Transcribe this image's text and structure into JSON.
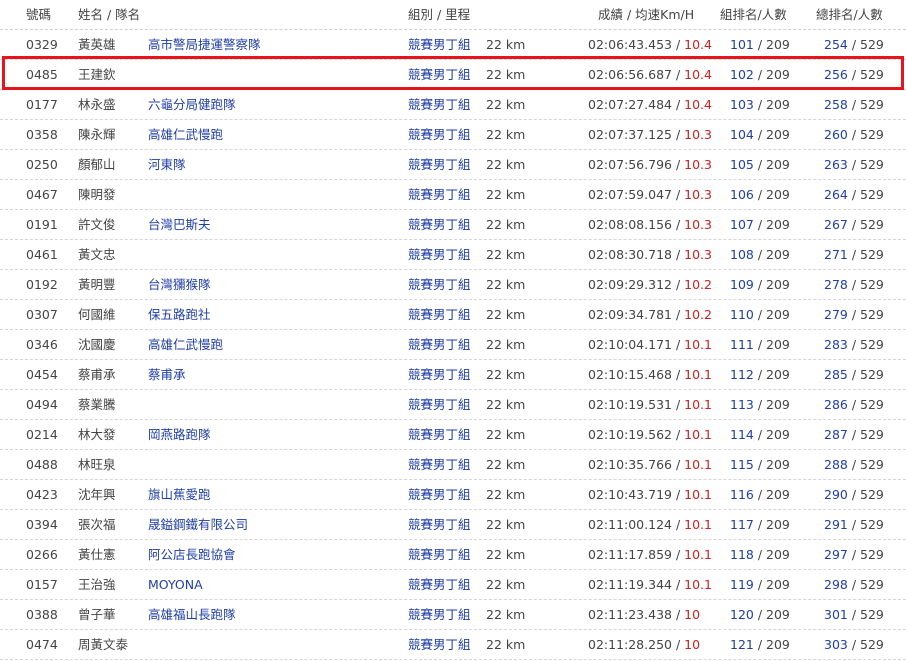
{
  "header": {
    "num": "號碼",
    "name_team": "姓名 / 隊名",
    "group_dist": "組別 / 里程",
    "time_speed": "成績 / 均速Km/H",
    "group_rank": "組排名/人數",
    "overall_rank": "總排名/人數"
  },
  "colors": {
    "link_blue": "#1f3ea8",
    "speed_red": "#cc1f1f",
    "highlight_red": "#e8141b"
  },
  "rows": [
    {
      "num": "0329",
      "name": "黃英雄",
      "team": "高市警局捷運警察隊",
      "group": "競賽男丁組",
      "dist": "22 km",
      "time": "02:06:43.453",
      "speed": "10.4",
      "grank": "101",
      "gtotal": "209",
      "orank": "254",
      "ototal": "529"
    },
    {
      "num": "0485",
      "name": "王建欽",
      "team": "",
      "group": "競賽男丁組",
      "dist": "22 km",
      "time": "02:06:56.687",
      "speed": "10.4",
      "grank": "102",
      "gtotal": "209",
      "orank": "256",
      "ototal": "529"
    },
    {
      "num": "0177",
      "name": "林永盛",
      "team": "六龜分局健跑隊",
      "group": "競賽男丁組",
      "dist": "22 km",
      "time": "02:07:27.484",
      "speed": "10.4",
      "grank": "103",
      "gtotal": "209",
      "orank": "258",
      "ototal": "529"
    },
    {
      "num": "0358",
      "name": "陳永輝",
      "team": "高雄仁武慢跑",
      "group": "競賽男丁組",
      "dist": "22 km",
      "time": "02:07:37.125",
      "speed": "10.3",
      "grank": "104",
      "gtotal": "209",
      "orank": "260",
      "ototal": "529"
    },
    {
      "num": "0250",
      "name": "顏郁山",
      "team": "河東隊",
      "group": "競賽男丁組",
      "dist": "22 km",
      "time": "02:07:56.796",
      "speed": "10.3",
      "grank": "105",
      "gtotal": "209",
      "orank": "263",
      "ototal": "529"
    },
    {
      "num": "0467",
      "name": "陳明發",
      "team": "",
      "group": "競賽男丁組",
      "dist": "22 km",
      "time": "02:07:59.047",
      "speed": "10.3",
      "grank": "106",
      "gtotal": "209",
      "orank": "264",
      "ototal": "529"
    },
    {
      "num": "0191",
      "name": "許文俊",
      "team": "台灣巴斯夫",
      "group": "競賽男丁組",
      "dist": "22 km",
      "time": "02:08:08.156",
      "speed": "10.3",
      "grank": "107",
      "gtotal": "209",
      "orank": "267",
      "ototal": "529"
    },
    {
      "num": "0461",
      "name": "黃文忠",
      "team": "",
      "group": "競賽男丁組",
      "dist": "22 km",
      "time": "02:08:30.718",
      "speed": "10.3",
      "grank": "108",
      "gtotal": "209",
      "orank": "271",
      "ototal": "529"
    },
    {
      "num": "0192",
      "name": "黃明豐",
      "team": "台灣獼猴隊",
      "group": "競賽男丁組",
      "dist": "22 km",
      "time": "02:09:29.312",
      "speed": "10.2",
      "grank": "109",
      "gtotal": "209",
      "orank": "278",
      "ototal": "529"
    },
    {
      "num": "0307",
      "name": "何國維",
      "team": "保五路跑社",
      "group": "競賽男丁組",
      "dist": "22 km",
      "time": "02:09:34.781",
      "speed": "10.2",
      "grank": "110",
      "gtotal": "209",
      "orank": "279",
      "ototal": "529"
    },
    {
      "num": "0346",
      "name": "沈國慶",
      "team": "高雄仁武慢跑",
      "group": "競賽男丁組",
      "dist": "22 km",
      "time": "02:10:04.171",
      "speed": "10.1",
      "grank": "111",
      "gtotal": "209",
      "orank": "283",
      "ototal": "529"
    },
    {
      "num": "0454",
      "name": "蔡甫承",
      "team": "蔡甫承",
      "group": "競賽男丁組",
      "dist": "22 km",
      "time": "02:10:15.468",
      "speed": "10.1",
      "grank": "112",
      "gtotal": "209",
      "orank": "285",
      "ototal": "529"
    },
    {
      "num": "0494",
      "name": "蔡業騰",
      "team": "",
      "group": "競賽男丁組",
      "dist": "22 km",
      "time": "02:10:19.531",
      "speed": "10.1",
      "grank": "113",
      "gtotal": "209",
      "orank": "286",
      "ototal": "529"
    },
    {
      "num": "0214",
      "name": "林大發",
      "team": "岡燕路跑隊",
      "group": "競賽男丁組",
      "dist": "22 km",
      "time": "02:10:19.562",
      "speed": "10.1",
      "grank": "114",
      "gtotal": "209",
      "orank": "287",
      "ototal": "529"
    },
    {
      "num": "0488",
      "name": "林旺泉",
      "team": "",
      "group": "競賽男丁組",
      "dist": "22 km",
      "time": "02:10:35.766",
      "speed": "10.1",
      "grank": "115",
      "gtotal": "209",
      "orank": "288",
      "ototal": "529"
    },
    {
      "num": "0423",
      "name": "沈年興",
      "team": "旗山蕉愛跑",
      "group": "競賽男丁組",
      "dist": "22 km",
      "time": "02:10:43.719",
      "speed": "10.1",
      "grank": "116",
      "gtotal": "209",
      "orank": "290",
      "ototal": "529"
    },
    {
      "num": "0394",
      "name": "張次福",
      "team": "晟鎰鋼鐵有限公司",
      "group": "競賽男丁組",
      "dist": "22 km",
      "time": "02:11:00.124",
      "speed": "10.1",
      "grank": "117",
      "gtotal": "209",
      "orank": "291",
      "ototal": "529"
    },
    {
      "num": "0266",
      "name": "黃仕憲",
      "team": "阿公店長跑協會",
      "group": "競賽男丁組",
      "dist": "22 km",
      "time": "02:11:17.859",
      "speed": "10.1",
      "grank": "118",
      "gtotal": "209",
      "orank": "297",
      "ototal": "529"
    },
    {
      "num": "0157",
      "name": "王治強",
      "team": "MOYONA",
      "group": "競賽男丁組",
      "dist": "22 km",
      "time": "02:11:19.344",
      "speed": "10.1",
      "grank": "119",
      "gtotal": "209",
      "orank": "298",
      "ototal": "529"
    },
    {
      "num": "0388",
      "name": "曾子華",
      "team": "高雄福山長跑隊",
      "group": "競賽男丁組",
      "dist": "22 km",
      "time": "02:11:23.438",
      "speed": "10",
      "grank": "120",
      "gtotal": "209",
      "orank": "301",
      "ototal": "529"
    },
    {
      "num": "0474",
      "name": "周黃文泰",
      "team": "",
      "group": "競賽男丁組",
      "dist": "22 km",
      "time": "02:11:28.250",
      "speed": "10",
      "grank": "121",
      "gtotal": "209",
      "orank": "303",
      "ototal": "529"
    }
  ]
}
